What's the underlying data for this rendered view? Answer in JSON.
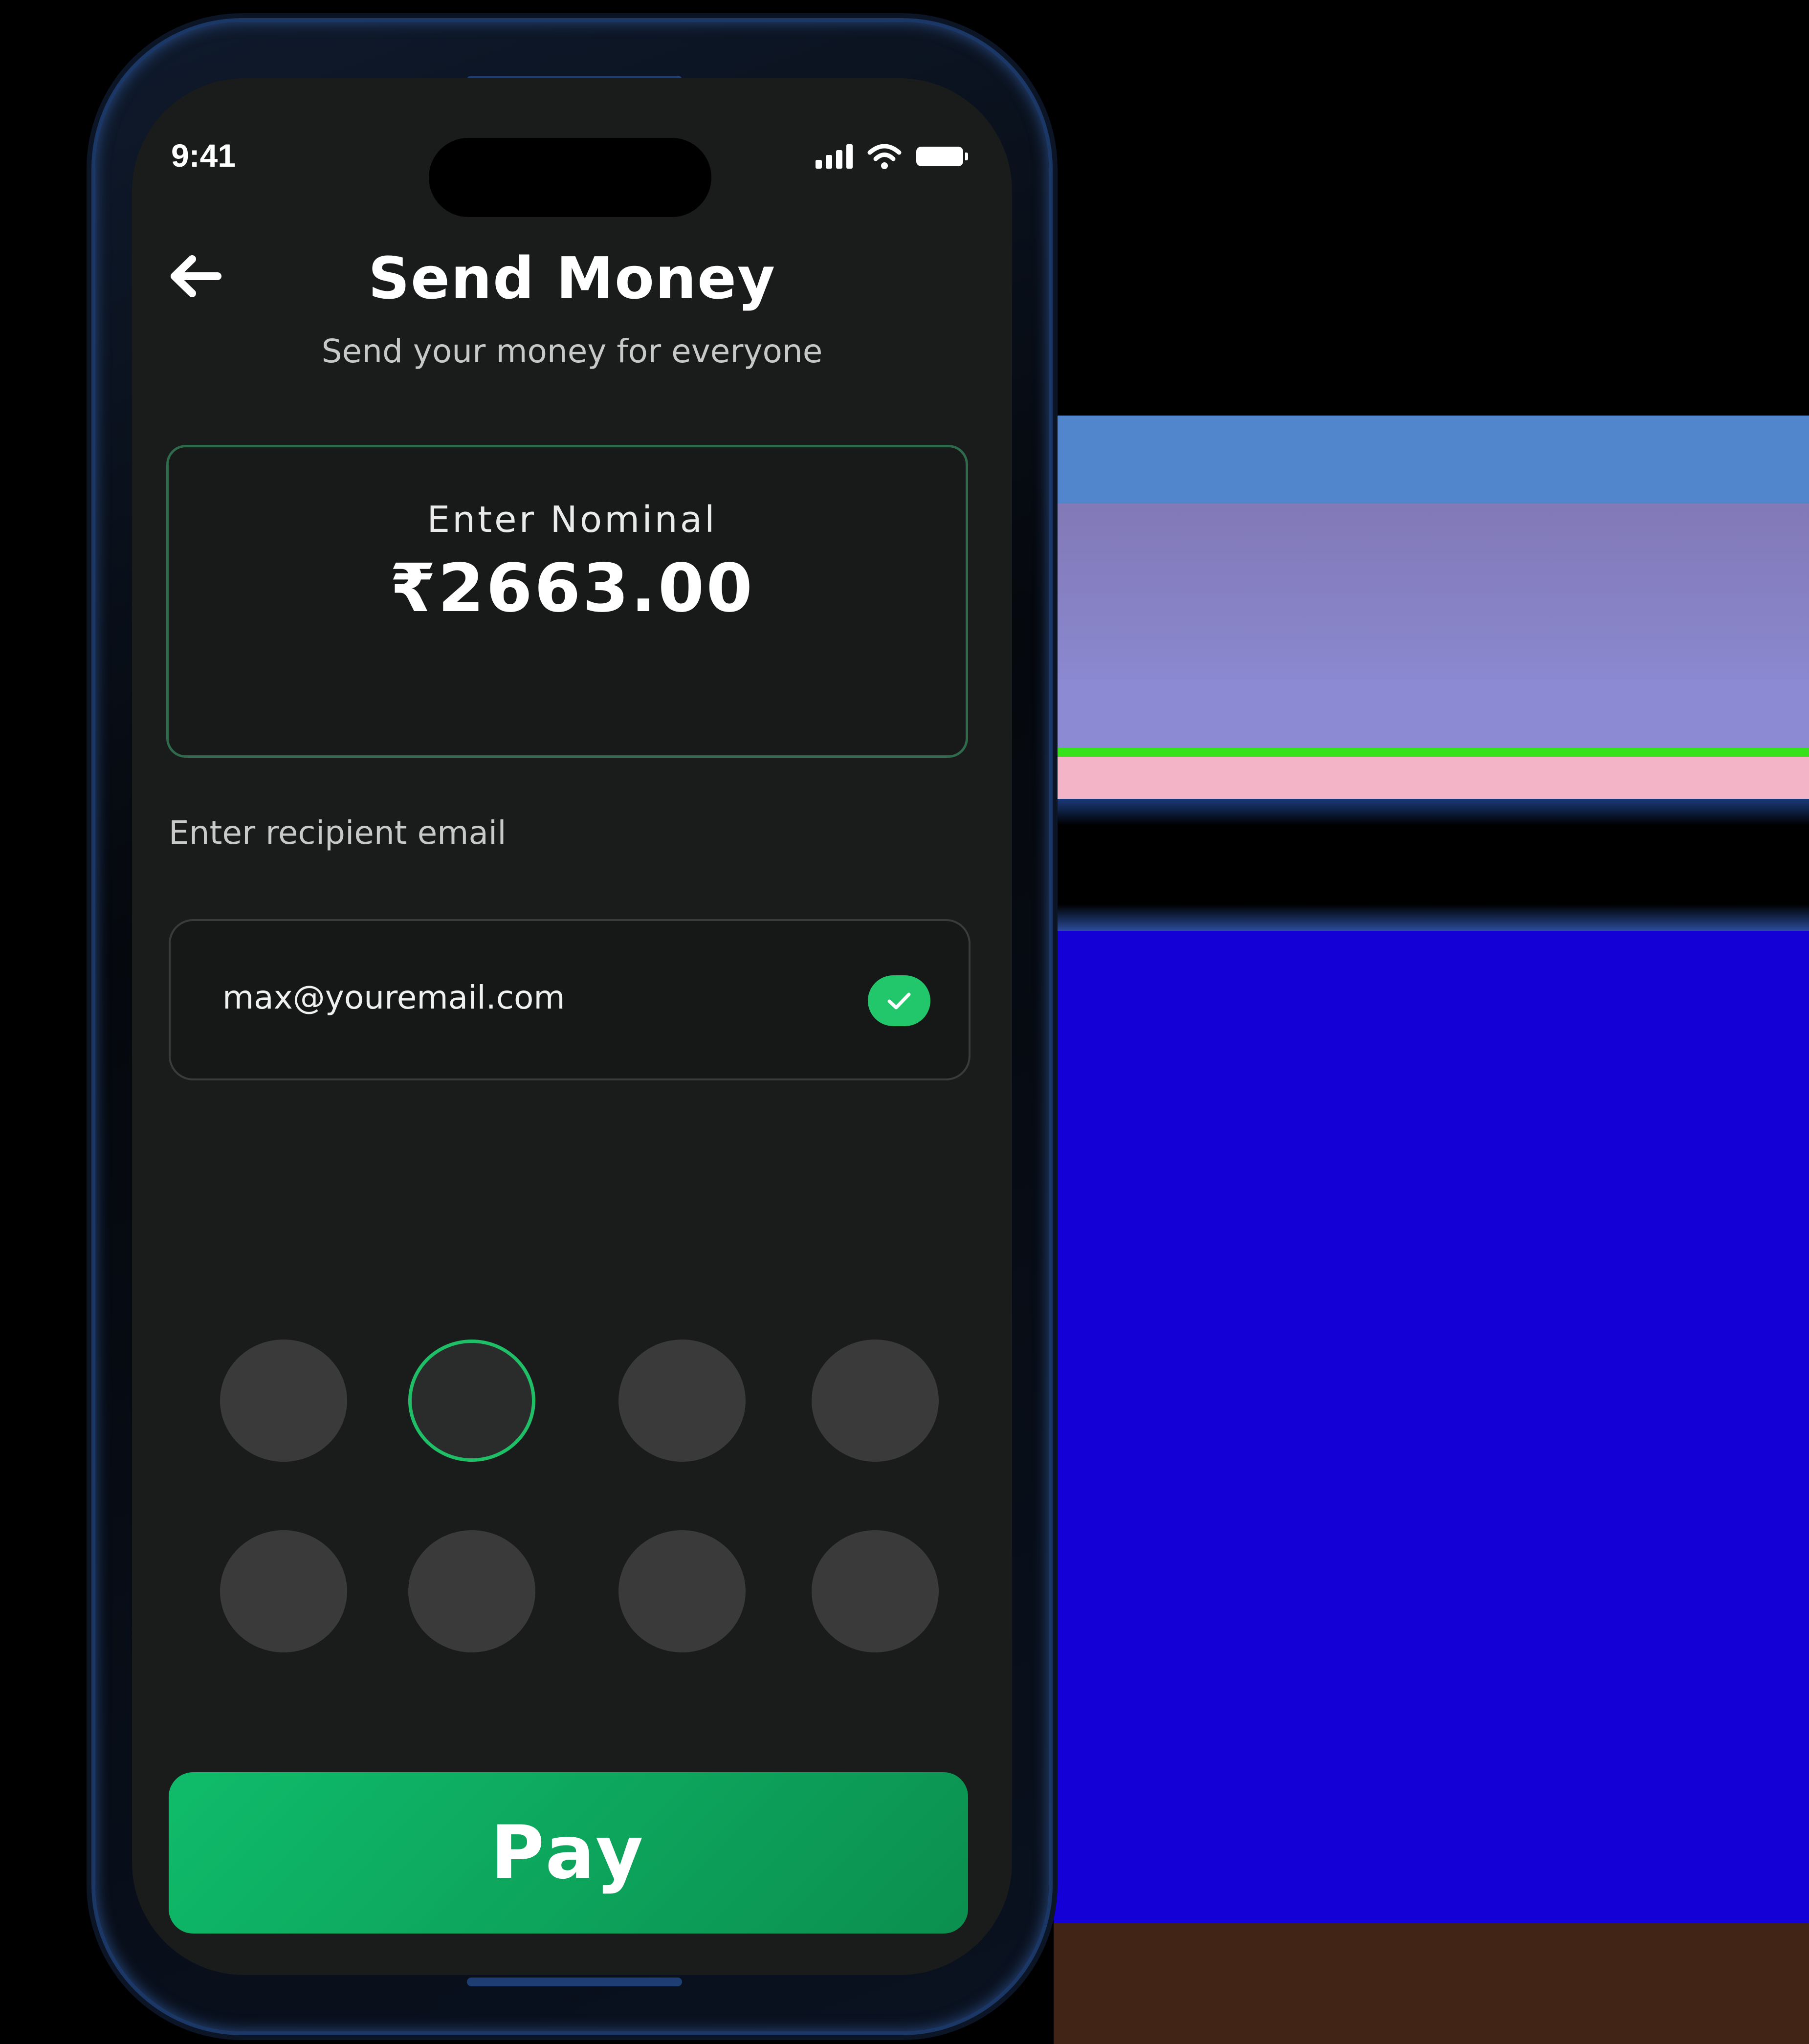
{
  "status_bar": {
    "time": "9:41"
  },
  "header": {
    "title": "Send Money",
    "subtitle": "Send your money for everyone"
  },
  "amount": {
    "label": "Enter Nominal",
    "value": "₹2663.00"
  },
  "recipient": {
    "label": "Enter recipient email",
    "email": "max@youremail.com",
    "verified": true
  },
  "pin": {
    "length": 8,
    "active_index": 1
  },
  "actions": {
    "pay_label": "Pay"
  },
  "colors": {
    "accent": "#1fbf68",
    "background": "#1a1b1b",
    "button": "#0b9a57"
  }
}
